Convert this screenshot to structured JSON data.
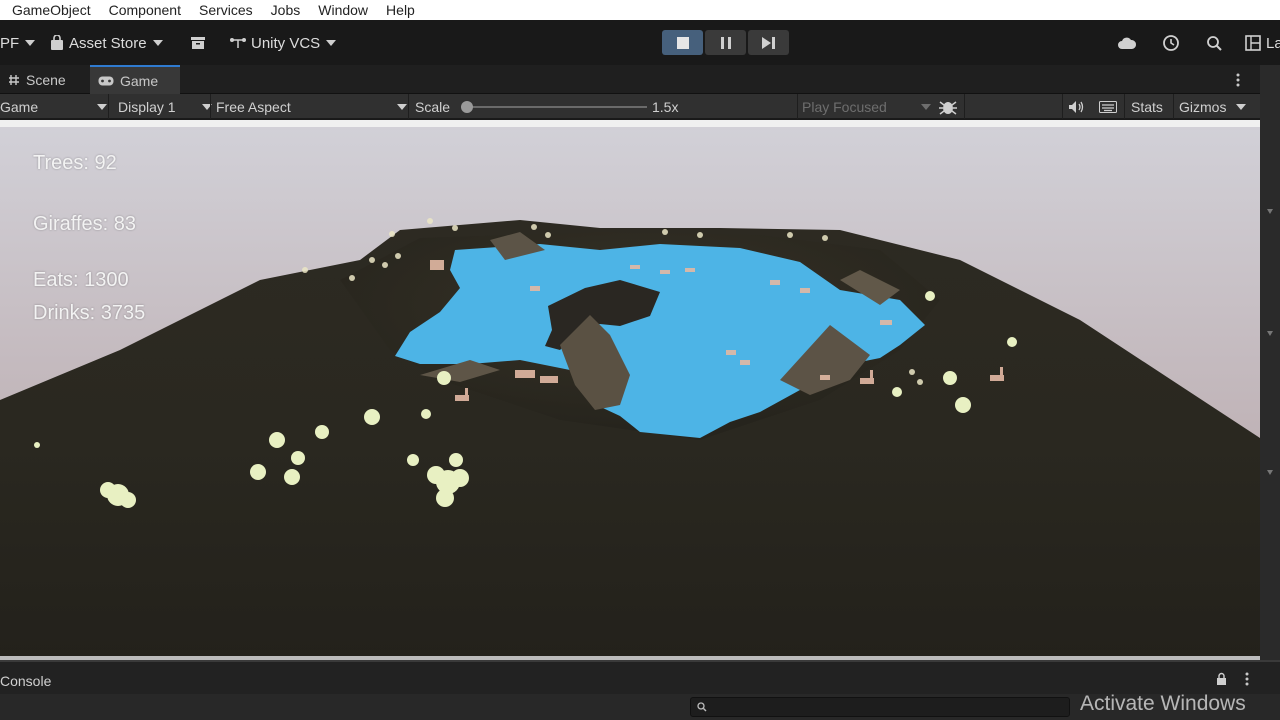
{
  "menu": [
    "GameObject",
    "Component",
    "Services",
    "Jobs",
    "Window",
    "Help"
  ],
  "toolbar": {
    "account_label": "PF",
    "asset_store_label": "Asset Store",
    "vcs_label": "Unity VCS",
    "right_cut_label": "La"
  },
  "tabs": {
    "scene": "Scene",
    "game": "Game"
  },
  "gamebar": {
    "mode": "Game",
    "display": "Display 1",
    "aspect": "Free Aspect",
    "scale_label": "Scale",
    "scale_value": "1.5x",
    "play_focused": "Play Focused",
    "stats": "Stats",
    "gizmos": "Gizmos"
  },
  "hud": {
    "trees": "Trees: 92",
    "giraffes": "Giraffes: 83",
    "eats": "Eats: 1300",
    "drinks": "Drinks: 3735"
  },
  "console": {
    "title": "Console"
  },
  "watermark": "Activate Windows",
  "colors": {
    "accent": "#2f7bd0",
    "water": "#4fb5e6",
    "terrain": "#2a261f",
    "sky": "#cfcbd4"
  }
}
